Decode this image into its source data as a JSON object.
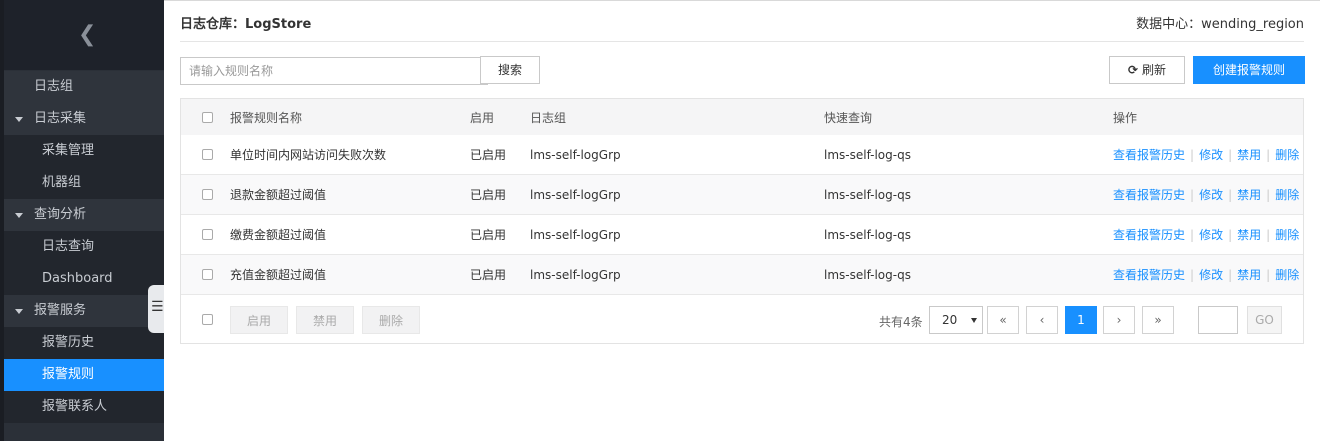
{
  "sidebar": {
    "back_icon": "chevron-left-icon",
    "items": [
      {
        "label": "日志组",
        "type": "group-plain"
      },
      {
        "label": "日志采集",
        "type": "group"
      },
      {
        "label": "采集管理",
        "type": "child"
      },
      {
        "label": "机器组",
        "type": "child"
      },
      {
        "label": "查询分析",
        "type": "group"
      },
      {
        "label": "日志查询",
        "type": "child"
      },
      {
        "label": "Dashboard",
        "type": "child"
      },
      {
        "label": "报警服务",
        "type": "group"
      },
      {
        "label": "报警历史",
        "type": "child"
      },
      {
        "label": "报警规则",
        "type": "child-active"
      },
      {
        "label": "报警联系人",
        "type": "child"
      }
    ],
    "collapse_icon": "menu-collapse-icon"
  },
  "header": {
    "store_label": "日志仓库：",
    "store_name": "LogStore",
    "region_label": "数据中心：",
    "region_name": "wending_region"
  },
  "toolbar": {
    "search_placeholder": "请输入规则名称",
    "search_button": "搜索",
    "refresh_button": "刷新",
    "create_button": "创建报警规则"
  },
  "table": {
    "columns": [
      "报警规则名称",
      "启用",
      "日志组",
      "快速查询",
      "操作"
    ],
    "rows": [
      {
        "name": "单位时间内网站访问失败次数",
        "enabled": "已启用",
        "group": "lms-self-logGrp",
        "query": "lms-self-log-qs"
      },
      {
        "name": "退款金额超过阈值",
        "enabled": "已启用",
        "group": "lms-self-logGrp",
        "query": "lms-self-log-qs"
      },
      {
        "name": "缴费金额超过阈值",
        "enabled": "已启用",
        "group": "lms-self-logGrp",
        "query": "lms-self-log-qs"
      },
      {
        "name": "充值金额超过阈值",
        "enabled": "已启用",
        "group": "lms-self-logGrp",
        "query": "lms-self-log-qs"
      }
    ],
    "actions": {
      "history": "查看报警历史",
      "edit": "修改",
      "disable": "禁用",
      "delete": "删除"
    }
  },
  "footer": {
    "enable_button": "启用",
    "disable_button": "禁用",
    "delete_button": "删除",
    "total_text": "共有4条",
    "page_size": "20",
    "first": "«",
    "prev": "‹",
    "current_page": "1",
    "next": "›",
    "last": "»",
    "go_button": "GO"
  },
  "colors": {
    "accent": "#1890ff",
    "sidebar_bg": "#2b3038"
  }
}
